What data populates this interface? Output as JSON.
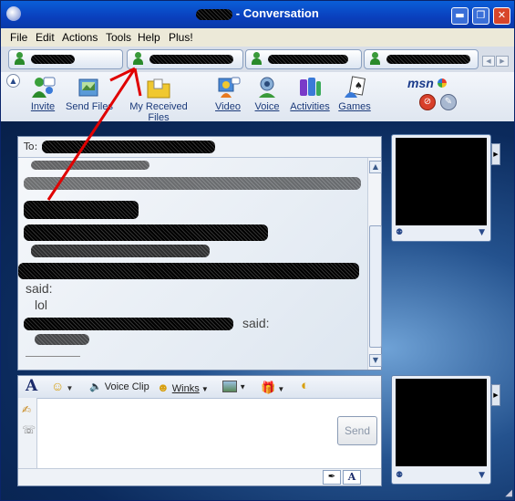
{
  "window": {
    "title": "- Conversation",
    "controls": {
      "minimize": "▬",
      "restore": "❐",
      "close": "✕"
    }
  },
  "menu": {
    "items": [
      {
        "label": "File"
      },
      {
        "label": "Edit"
      },
      {
        "label": "Actions"
      },
      {
        "label": "Tools"
      },
      {
        "label": "Help"
      },
      {
        "label": "Plus!"
      }
    ]
  },
  "toolbar": {
    "buttons": [
      {
        "label": "Invite",
        "icon": "invite-icon"
      },
      {
        "label": "Send Files",
        "icon": "send-files-icon"
      },
      {
        "label": "My Received Files",
        "icon": "folder-icon"
      },
      {
        "label": "Video",
        "icon": "video-icon"
      },
      {
        "label": "Voice",
        "icon": "voice-icon"
      },
      {
        "label": "Activities",
        "icon": "activities-icon"
      },
      {
        "label": "Games",
        "icon": "games-icon"
      }
    ],
    "brand": "msn"
  },
  "history": {
    "to_label": "To:",
    "lines": [
      "said:",
      "lol",
      "said:"
    ]
  },
  "compose": {
    "font_label": "A",
    "voice_clip_label": "Voice Clip",
    "winks_label": "Winks",
    "send_label": "Send"
  },
  "colors": {
    "titlebar": "#0a3fbd",
    "arrow": "#e00000",
    "background": "#0b2a5c"
  }
}
